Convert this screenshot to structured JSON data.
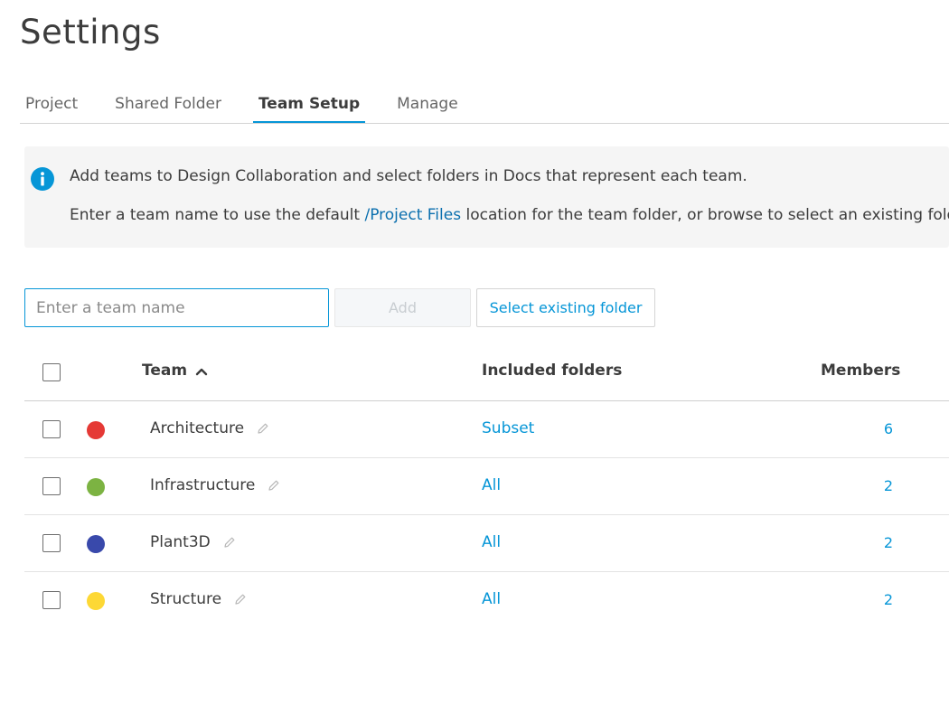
{
  "page": {
    "title": "Settings"
  },
  "tabs": [
    {
      "label": "Project",
      "active": false
    },
    {
      "label": "Shared Folder",
      "active": false
    },
    {
      "label": "Team Setup",
      "active": true
    },
    {
      "label": "Manage",
      "active": false
    }
  ],
  "info": {
    "icon": "info-icon",
    "line1": "Add teams to Design Collaboration and select folders in Docs that represent each team.",
    "line2_before": "Enter a team name to use the default ",
    "line2_link": "/Project Files",
    "line2_after": " location for the team folder, or browse to select an existing folder."
  },
  "controls": {
    "input_placeholder": "Enter a team name",
    "input_value": "",
    "add_label": "Add",
    "select_folder_label": "Select existing folder"
  },
  "table": {
    "headers": {
      "team": "Team",
      "folders": "Included folders",
      "members": "Members"
    },
    "rows": [
      {
        "name": "Architecture",
        "color": "#e53935",
        "folders": "Subset",
        "members": "6"
      },
      {
        "name": "Infrastructure",
        "color": "#7cb342",
        "folders": "All",
        "members": "2"
      },
      {
        "name": "Plant3D",
        "color": "#3949ab",
        "folders": "All",
        "members": "2"
      },
      {
        "name": "Structure",
        "color": "#fdd835",
        "folders": "All",
        "members": "2"
      }
    ]
  },
  "colors": {
    "accent": "#0696d7",
    "link": "#0b6fae",
    "banner_bg": "#f5f5f5"
  }
}
